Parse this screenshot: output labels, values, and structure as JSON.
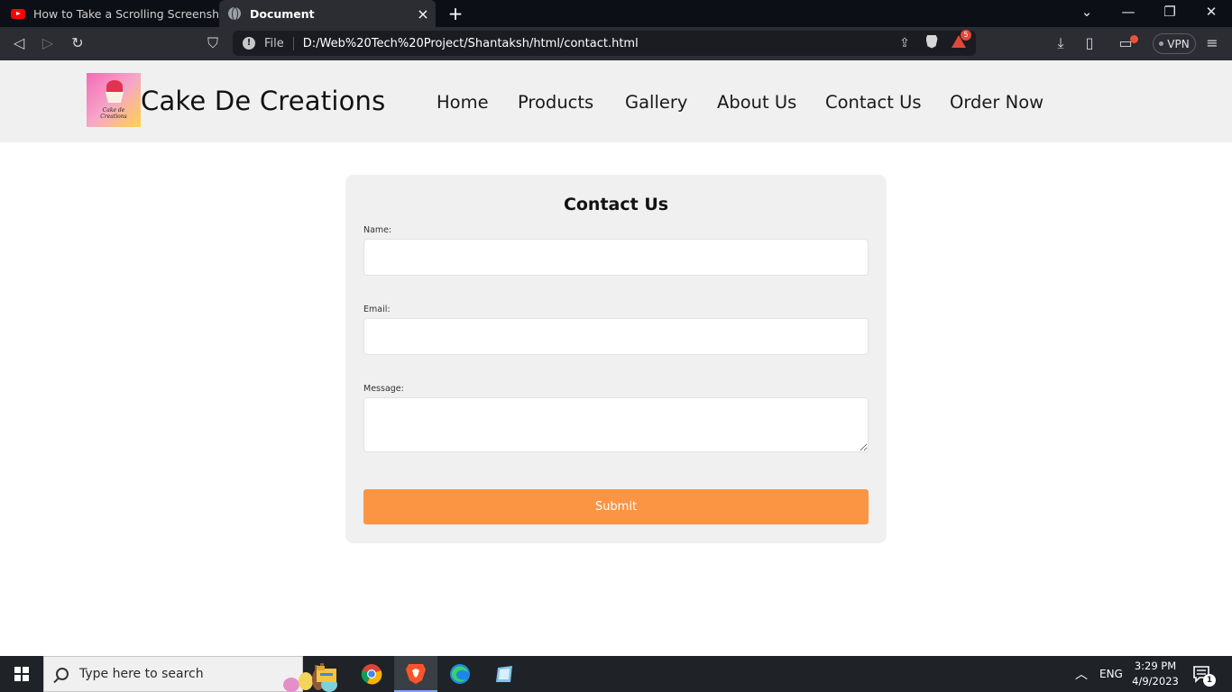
{
  "browser": {
    "tabs": [
      {
        "title": "How to Take a Scrolling Screenshot in",
        "icon": "youtube-icon"
      },
      {
        "title": "Document",
        "icon": "globe-icon",
        "active": true
      }
    ],
    "new_tab_symbol": "+",
    "window_controls": {
      "minimize": "—",
      "restore": "❐",
      "close": "✕",
      "tab_search": "⌄"
    },
    "nav": {
      "back": "◁",
      "forward": "▷",
      "reload": "↻",
      "bookmark": "⛉"
    },
    "address": {
      "scheme_label": "File",
      "url": "D:/Web%20Tech%20Project/Shantaksh/html/contact.html",
      "rewards_badge": "5"
    },
    "right_icons": {
      "download": "⤓",
      "sidebar": "▯",
      "wallet": "▭",
      "menu": "≡"
    },
    "vpn_label": "VPN"
  },
  "site": {
    "logo_text": "Cake de Creations",
    "brand": "Cake De Creations",
    "nav": [
      "Home",
      "Products",
      "Gallery",
      "About Us",
      "Contact Us",
      "Order Now"
    ]
  },
  "form": {
    "title": "Contact Us",
    "name_label": "Name:",
    "email_label": "Email:",
    "message_label": "Message:",
    "submit_label": "Submit",
    "submit_color": "#fb9443"
  },
  "taskbar": {
    "search_placeholder": "Type here to search",
    "apps": [
      "file-explorer-icon",
      "chrome-icon",
      "brave-icon",
      "edge-icon",
      "notepad-icon"
    ],
    "language": "ENG",
    "time": "3:29 PM",
    "date": "4/9/2023",
    "notification_count": "1",
    "tray_chevron": "︿"
  }
}
